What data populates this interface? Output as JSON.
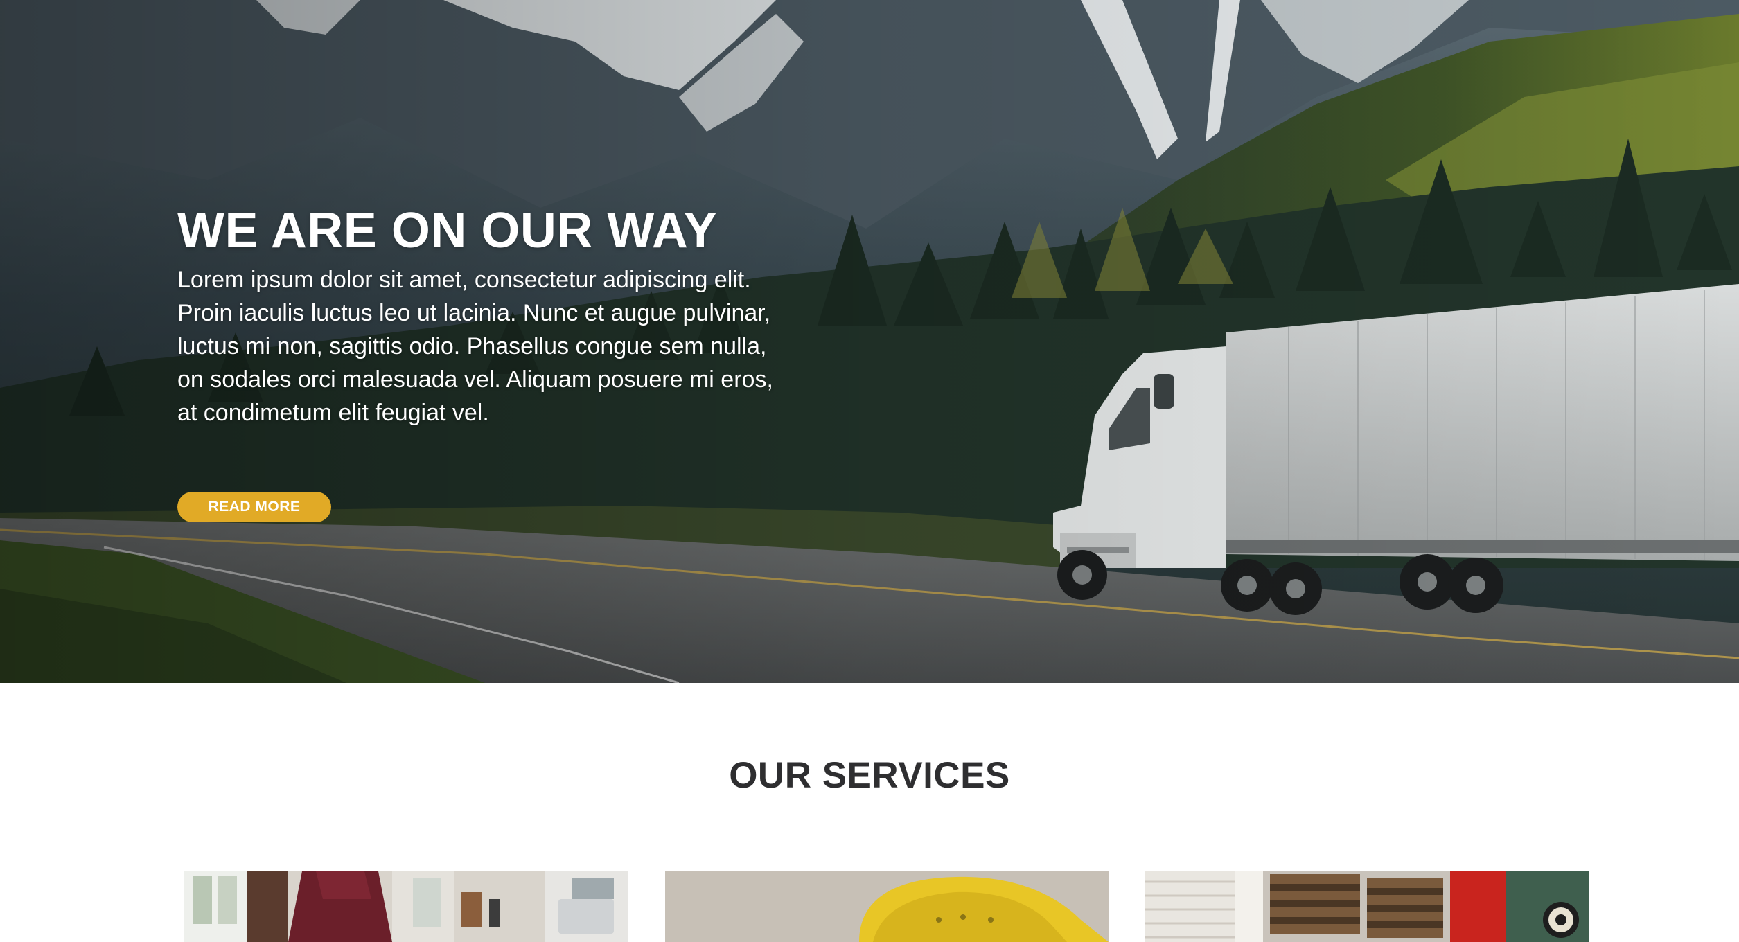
{
  "hero": {
    "title": "WE ARE ON OUR WAY",
    "text": "Lorem ipsum dolor sit amet, consectetur adipiscing elit. Proin iaculis luctus leo ut lacinia. Nunc et augue pulvinar, luctus mi non, sagittis odio. Phasellus congue sem nulla, on sodales orci malesuada vel. Aliquam posuere mi eros, at condimetum elit feugiat vel.",
    "button_label": "READ MORE",
    "accent_color": "#e1aa26",
    "background_image": "mountain-highway-truck-photo"
  },
  "services": {
    "title": "OUR SERVICES",
    "cards": [
      {
        "image": "office-workspace-photo"
      },
      {
        "image": "yellow-chair-photo"
      },
      {
        "image": "stacked-pallets-photo"
      }
    ]
  }
}
